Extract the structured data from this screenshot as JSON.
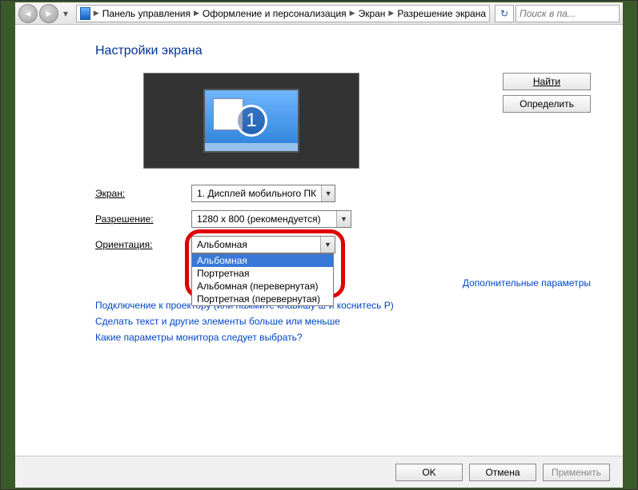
{
  "toolbar": {
    "breadcrumb": [
      "Панель управления",
      "Оформление и персонализация",
      "Экран",
      "Разрешение экрана"
    ],
    "search_placeholder": "Поиск в па..."
  },
  "page": {
    "title": "Настройки экрана",
    "monitor_number": "1",
    "find_btn": "Найти",
    "identify_btn": "Определить",
    "display_label": "Экран:",
    "display_value": "1. Дисплей мобильного ПК",
    "resolution_label": "Разрешение:",
    "resolution_value": "1280 x 800 (рекомендуется)",
    "orientation_label": "Ориентация:",
    "orientation_value": "Альбомная",
    "orientation_options": [
      "Альбомная",
      "Портретная",
      "Альбомная (перевернутая)",
      "Портретная (перевернутая)"
    ],
    "advanced_link": "Дополнительные параметры",
    "link_projector": "Подключение к проектору (или нажмите клавишу ⊞ и коснитесь P)",
    "link_textsize": "Сделать текст и другие элементы больше или меньше",
    "link_which": "Какие параметры монитора следует выбрать?"
  },
  "footer": {
    "ok": "OK",
    "cancel": "Отмена",
    "apply": "Применить"
  }
}
